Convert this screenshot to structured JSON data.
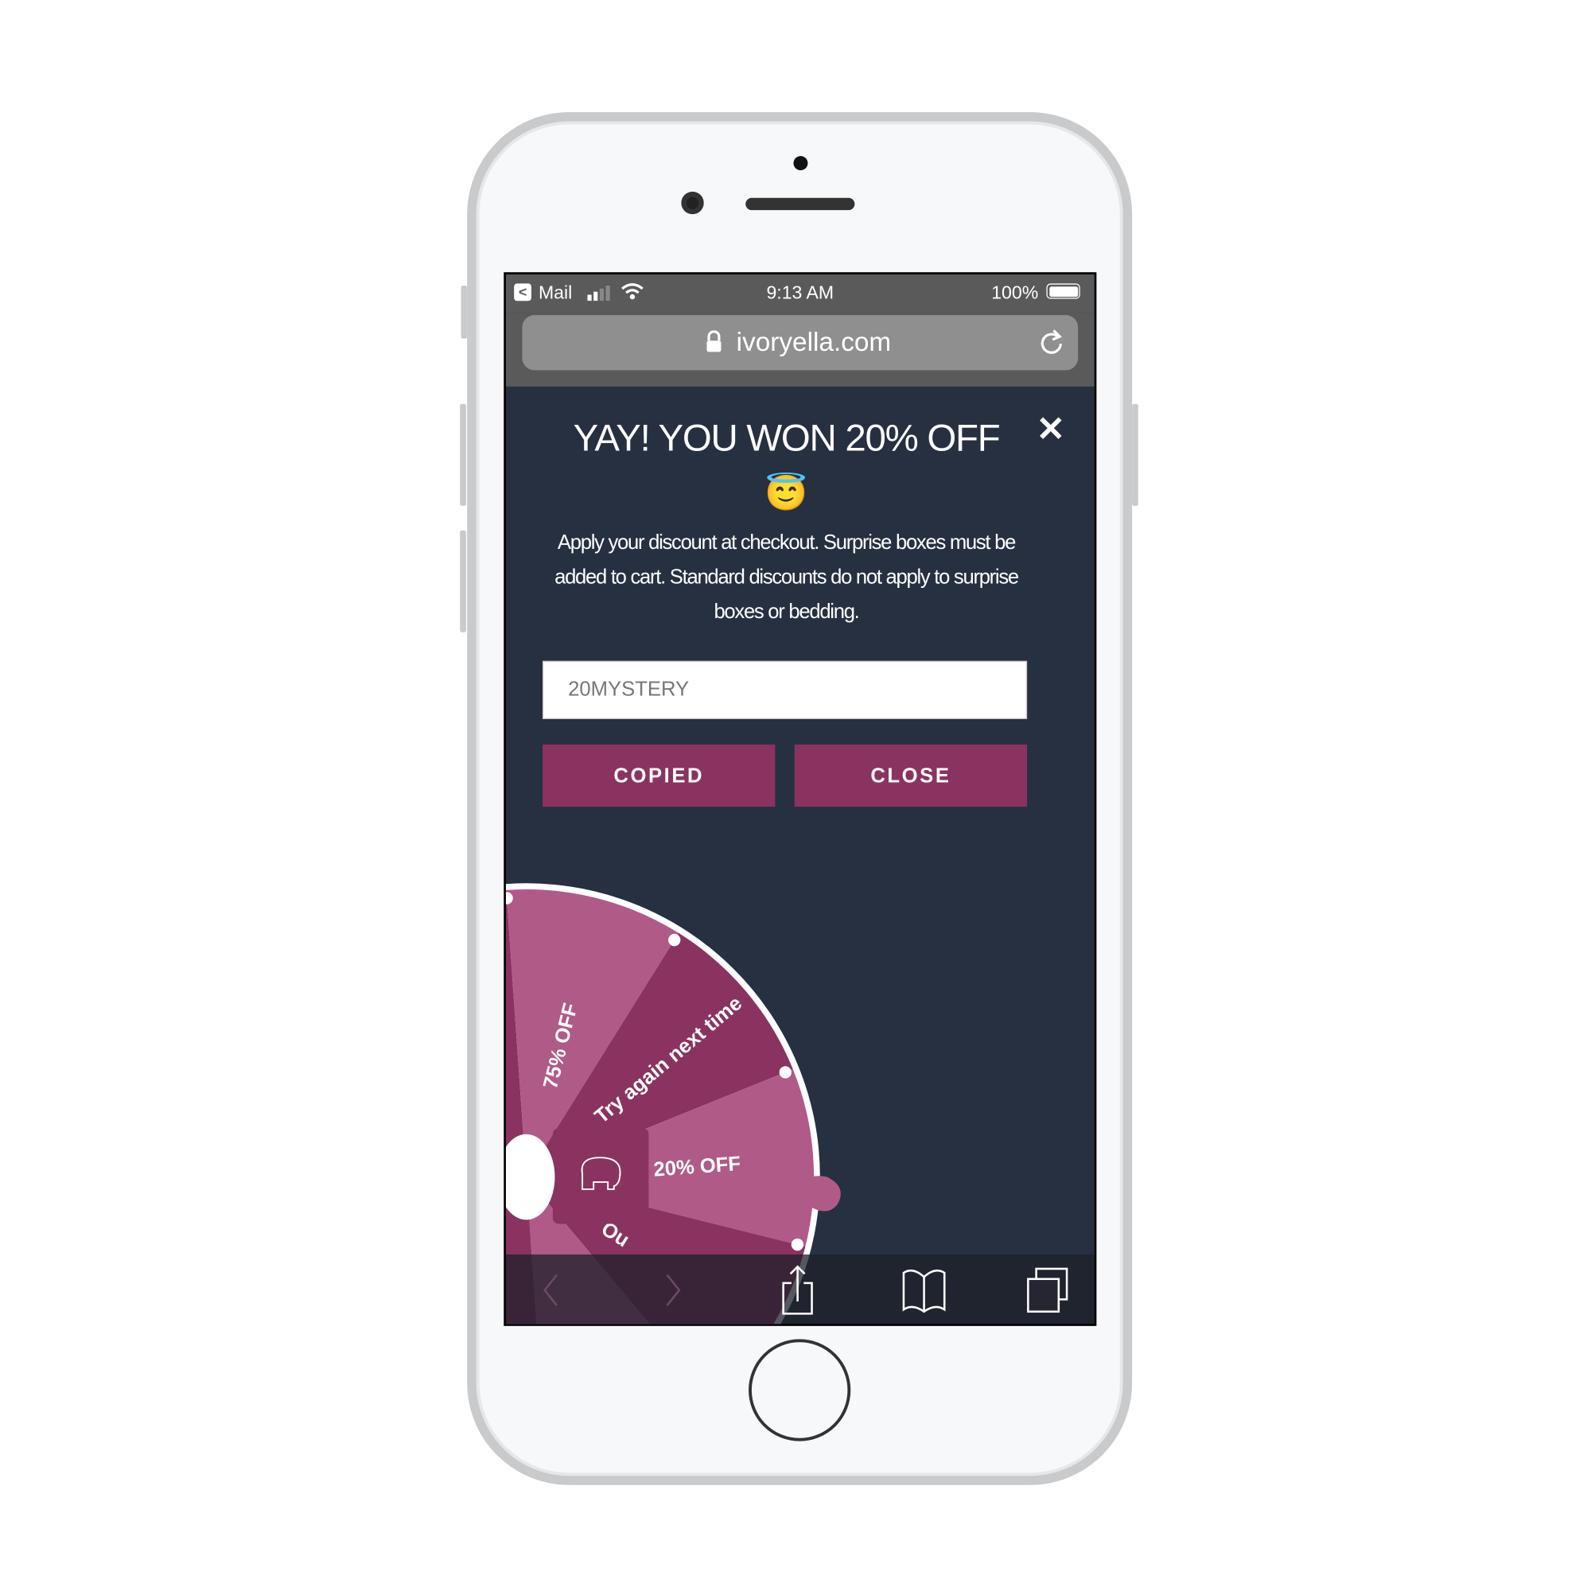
{
  "status_bar": {
    "back_app": "Mail",
    "time": "9:13 AM",
    "battery": "100%",
    "battery_level": 1.0
  },
  "browser": {
    "url": "ivoryella.com"
  },
  "popup": {
    "title": "YAY! YOU WON 20% OFF",
    "emoji": "😇",
    "description": "Apply your discount at checkout. Surprise boxes must be added to cart. Standard discounts do not apply to surprise boxes or bedding.",
    "code_value": "20MYSTERY",
    "copied_label": "COPIED",
    "close_label": "CLOSE"
  },
  "wheel": {
    "segments": [
      "75% OFF",
      "Try again next time",
      "20% OFF",
      "Ou"
    ],
    "colors": {
      "dark": "#8a3360",
      "light": "#b05a88"
    }
  },
  "colors": {
    "background": "#263040",
    "accent": "#8a3360"
  }
}
